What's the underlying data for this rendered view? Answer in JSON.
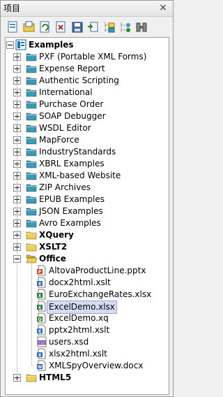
{
  "window": {
    "title": "项目",
    "close": "×"
  },
  "toolbar": [
    {
      "name": "new-project-icon"
    },
    {
      "name": "open-project-icon"
    },
    {
      "name": "reload-project-icon"
    },
    {
      "name": "close-project-icon"
    },
    {
      "name": "save-project-icon"
    },
    {
      "name": "add-files-icon"
    },
    {
      "name": "add-folder-icon"
    },
    {
      "name": "add-url-icon"
    },
    {
      "name": "properties-icon"
    }
  ],
  "tree": {
    "root": "Examples",
    "items": [
      {
        "label": "PXF (Portable XML Forms)",
        "bold": false
      },
      {
        "label": "Expense Report",
        "bold": false
      },
      {
        "label": "Authentic Scripting",
        "bold": false
      },
      {
        "label": "International",
        "bold": false
      },
      {
        "label": "Purchase Order",
        "bold": false
      },
      {
        "label": "SOAP Debugger",
        "bold": false
      },
      {
        "label": "WSDL Editor",
        "bold": false
      },
      {
        "label": "MapForce",
        "bold": false
      },
      {
        "label": "IndustryStandards",
        "bold": false
      },
      {
        "label": "XBRL Examples",
        "bold": false
      },
      {
        "label": "XML-based Website",
        "bold": false
      },
      {
        "label": "ZIP Archives",
        "bold": false
      },
      {
        "label": "EPUB Examples",
        "bold": false
      },
      {
        "label": "JSON Examples",
        "bold": false
      },
      {
        "label": "Avro Examples",
        "bold": false
      },
      {
        "label": "XQuery",
        "bold": true
      },
      {
        "label": "XSLT2",
        "bold": true
      },
      {
        "label": "Office",
        "bold": true
      }
    ],
    "office_files": [
      {
        "label": "AltovaProductLine.pptx",
        "type": "pptx"
      },
      {
        "label": "docx2html.xslt",
        "type": "xslt"
      },
      {
        "label": "EuroExchangeRates.xlsx",
        "type": "xlsx"
      },
      {
        "label": "ExcelDemo.xlsx",
        "type": "xlsx",
        "selected": true
      },
      {
        "label": "ExcelDemo.xq",
        "type": "xq"
      },
      {
        "label": "pptx2html.xslt",
        "type": "xslt"
      },
      {
        "label": "users.xsd",
        "type": "xsd"
      },
      {
        "label": "xlsx2html.xslt",
        "type": "xslt"
      },
      {
        "label": "XMLSpyOverview.docx",
        "type": "docx"
      }
    ],
    "last": {
      "label": "HTML5",
      "bold": true
    }
  },
  "colors": {
    "blue_folder": "#3a9ab8",
    "yellow_folder": "#f2cf4a",
    "selection": "#d6dcf5"
  }
}
